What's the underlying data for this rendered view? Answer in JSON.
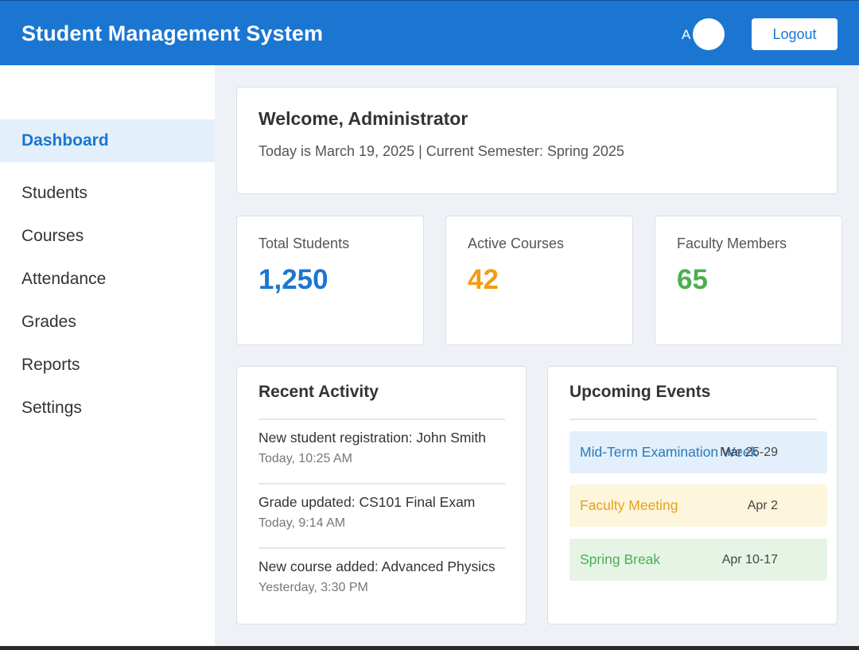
{
  "header": {
    "title": "Student Management System",
    "avatar_initial": "A",
    "logout_label": "Logout"
  },
  "sidebar": {
    "items": [
      {
        "label": "Dashboard",
        "active": true
      },
      {
        "label": "Students",
        "active": false
      },
      {
        "label": "Courses",
        "active": false
      },
      {
        "label": "Attendance",
        "active": false
      },
      {
        "label": "Grades",
        "active": false
      },
      {
        "label": "Reports",
        "active": false
      },
      {
        "label": "Settings",
        "active": false
      }
    ]
  },
  "welcome": {
    "title": "Welcome, Administrator",
    "subtitle": "Today is March 19, 2025 | Current Semester: Spring 2025"
  },
  "stats": [
    {
      "label": "Total Students",
      "value": "1,250",
      "color": "#1b76d2"
    },
    {
      "label": "Active Courses",
      "value": "42",
      "color": "#f39c12"
    },
    {
      "label": "Faculty Members",
      "value": "65",
      "color": "#4caf50"
    }
  ],
  "activity": {
    "title": "Recent Activity",
    "items": [
      {
        "text": "New student registration: John Smith",
        "time": "Today, 10:25 AM"
      },
      {
        "text": "Grade updated: CS101 Final Exam",
        "time": "Today, 9:14 AM"
      },
      {
        "text": "New course added: Advanced Physics",
        "time": "Yesterday, 3:30 PM"
      }
    ]
  },
  "events": {
    "title": "Upcoming Events",
    "items": [
      {
        "name": "Mid-Term Examination Week",
        "date": "Mar 25-29",
        "bg": "#e3f0fb",
        "color": "#2a7ab8"
      },
      {
        "name": "Faculty Meeting",
        "date": "Apr 2",
        "bg": "#fdf5dc",
        "color": "#e6a21c"
      },
      {
        "name": "Spring Break",
        "date": "Apr 10-17",
        "bg": "#e6f4e6",
        "color": "#4caf50"
      }
    ]
  }
}
